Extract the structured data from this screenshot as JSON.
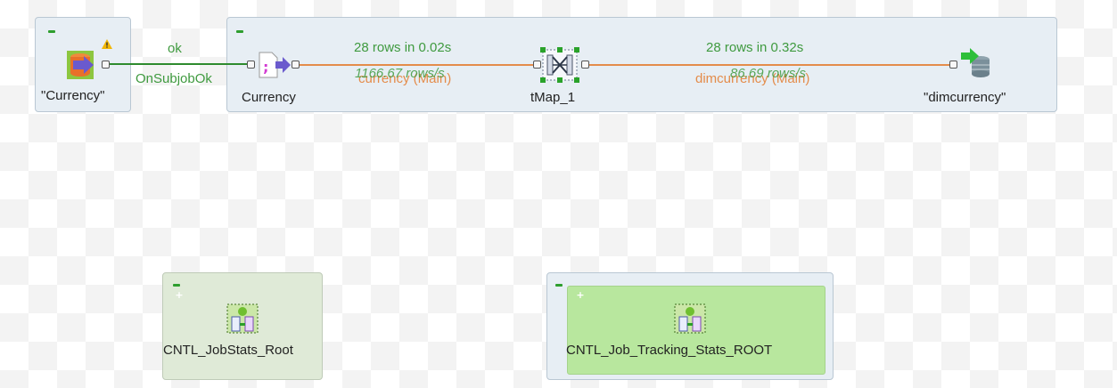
{
  "subjobs": {
    "main_label": "",
    "left_component_label": "\"Currency\"",
    "currency_label": "Currency",
    "tmap_label": "tMap_1",
    "dimcurrency_label": "\"dimcurrency\""
  },
  "links": {
    "ok_label": "ok",
    "onsubjobok_label": "OnSubjobOk",
    "flow1_rows": "28 rows in 0.02s",
    "flow1_rate": "1166.67 rows/s",
    "flow1_name": "currency (Main)",
    "flow2_rows": "28 rows in 0.32s",
    "flow2_rate": "86.69 rows/s",
    "flow2_name": "dimcurrency (Main)"
  },
  "bottom": {
    "jobstats_label": "CNTL_JobStats_Root",
    "tracking_label": "CNTL_Job_Tracking_Stats_ROOT"
  },
  "colors": {
    "subjob_bg": "#e7eef4",
    "green_link": "#2e8b2e",
    "orange_link": "#e48c4a",
    "green_box": "#b8e79e"
  },
  "icons": {
    "warning": "warning-icon",
    "db_input": "db-input-icon",
    "file_input": "file-delimited-icon",
    "tmap": "tmap-icon",
    "db_output": "db-output-icon",
    "joblet": "joblet-icon"
  }
}
